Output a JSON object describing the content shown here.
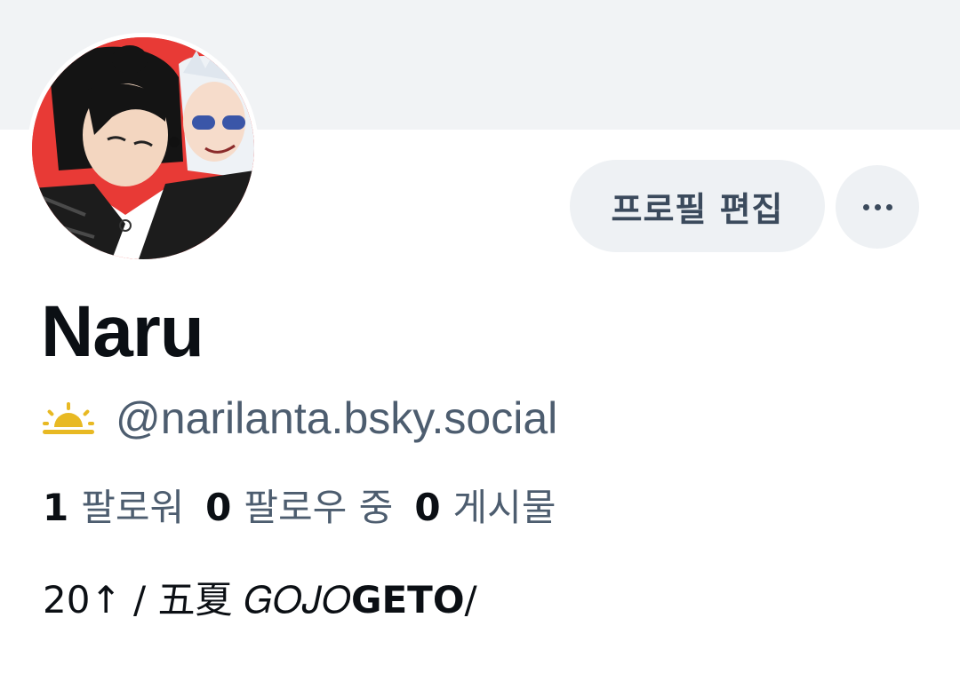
{
  "profile": {
    "display_name": "Naru",
    "handle": "@narilanta.bsky.social",
    "handle_icon": "sunrise-icon",
    "bio": "20↑ / 五夏 𝐺𝑂𝐽𝑂𝗚𝗘𝗧𝗢/"
  },
  "actions": {
    "edit_label": "프로필 편집",
    "more_icon": "ellipsis-icon"
  },
  "stats": {
    "followers_count": "1",
    "followers_label": "팔로워",
    "following_count": "0",
    "following_label": "팔로우 중",
    "posts_count": "0",
    "posts_label": "게시물"
  },
  "colors": {
    "banner": "#f1f3f5",
    "button_bg": "#eef1f4",
    "button_text": "#3b4a5c",
    "secondary_text": "#4d5d6f",
    "sun_icon": "#e8b923"
  }
}
